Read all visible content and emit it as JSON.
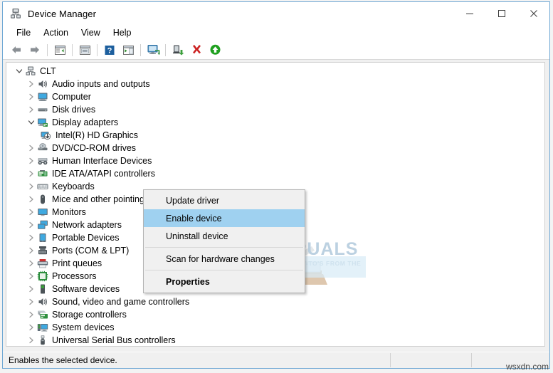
{
  "window": {
    "title": "Device Manager",
    "title_icon": "device-manager-icon",
    "controls": {
      "minimize": "minimize-icon",
      "maximize": "maximize-icon",
      "close": "close-icon"
    }
  },
  "menubar": {
    "items": [
      {
        "label": "File"
      },
      {
        "label": "Action"
      },
      {
        "label": "View"
      },
      {
        "label": "Help"
      }
    ]
  },
  "toolbar": {
    "buttons": [
      {
        "name": "back-icon",
        "title": "Back"
      },
      {
        "name": "forward-icon",
        "title": "Forward"
      },
      {
        "name": "separator-1",
        "title": ""
      },
      {
        "name": "show-hide-console-tree-icon",
        "title": "Show/Hide Console Tree"
      },
      {
        "name": "separator-2",
        "title": ""
      },
      {
        "name": "properties-icon",
        "title": "Properties"
      },
      {
        "name": "separator-3",
        "title": ""
      },
      {
        "name": "help-icon",
        "title": "Help"
      },
      {
        "name": "show-hide-action-pane-icon",
        "title": "Show/Hide Action Pane"
      },
      {
        "name": "separator-4",
        "title": ""
      },
      {
        "name": "scan-for-hardware-changes-icon",
        "title": "Scan for hardware changes"
      },
      {
        "name": "separator-5",
        "title": ""
      },
      {
        "name": "update-driver-icon",
        "title": "Update Driver Software"
      },
      {
        "name": "uninstall-device-icon",
        "title": "Uninstall device"
      },
      {
        "name": "enable-device-icon",
        "title": "Enable device"
      }
    ]
  },
  "tree": {
    "nodes": [
      {
        "label": "CLT",
        "depth": 0,
        "expander": "expanded",
        "icon": "computer-root-icon",
        "selected": false
      },
      {
        "label": "Audio inputs and outputs",
        "depth": 1,
        "expander": "collapsed",
        "icon": "audio-icon",
        "selected": false
      },
      {
        "label": "Computer",
        "depth": 1,
        "expander": "collapsed",
        "icon": "computer-icon",
        "selected": false
      },
      {
        "label": "Disk drives",
        "depth": 1,
        "expander": "collapsed",
        "icon": "disk-drive-icon",
        "selected": false
      },
      {
        "label": "Display adapters",
        "depth": 1,
        "expander": "expanded",
        "icon": "display-adapter-icon",
        "selected": false
      },
      {
        "label": "Intel(R) HD Graphics",
        "depth": 2,
        "expander": "none",
        "icon": "display-adapter-disabled-icon",
        "selected": true
      },
      {
        "label": "DVD/CD-ROM drives",
        "depth": 1,
        "expander": "collapsed",
        "icon": "dvd-drive-icon",
        "selected": false
      },
      {
        "label": "Human Interface Devices",
        "depth": 1,
        "expander": "collapsed",
        "icon": "hid-icon",
        "selected": false
      },
      {
        "label": "IDE ATA/ATAPI controllers",
        "depth": 1,
        "expander": "collapsed",
        "icon": "ide-controller-icon",
        "selected": false
      },
      {
        "label": "Keyboards",
        "depth": 1,
        "expander": "collapsed",
        "icon": "keyboard-icon",
        "selected": false
      },
      {
        "label": "Mice and other pointing devices",
        "depth": 1,
        "expander": "collapsed",
        "icon": "mouse-icon",
        "selected": false
      },
      {
        "label": "Monitors",
        "depth": 1,
        "expander": "collapsed",
        "icon": "monitor-icon",
        "selected": false
      },
      {
        "label": "Network adapters",
        "depth": 1,
        "expander": "collapsed",
        "icon": "network-adapter-icon",
        "selected": false
      },
      {
        "label": "Portable Devices",
        "depth": 1,
        "expander": "collapsed",
        "icon": "portable-device-icon",
        "selected": false
      },
      {
        "label": "Ports (COM & LPT)",
        "depth": 1,
        "expander": "collapsed",
        "icon": "port-icon",
        "selected": false
      },
      {
        "label": "Print queues",
        "depth": 1,
        "expander": "collapsed",
        "icon": "printer-icon",
        "selected": false
      },
      {
        "label": "Processors",
        "depth": 1,
        "expander": "collapsed",
        "icon": "processor-icon",
        "selected": false
      },
      {
        "label": "Software devices",
        "depth": 1,
        "expander": "collapsed",
        "icon": "software-device-icon",
        "selected": false
      },
      {
        "label": "Sound, video and game controllers",
        "depth": 1,
        "expander": "collapsed",
        "icon": "sound-controller-icon",
        "selected": false
      },
      {
        "label": "Storage controllers",
        "depth": 1,
        "expander": "collapsed",
        "icon": "storage-controller-icon",
        "selected": false
      },
      {
        "label": "System devices",
        "depth": 1,
        "expander": "collapsed",
        "icon": "system-device-icon",
        "selected": false
      },
      {
        "label": "Universal Serial Bus controllers",
        "depth": 1,
        "expander": "collapsed",
        "icon": "usb-controller-icon",
        "selected": false
      }
    ]
  },
  "context_menu": {
    "items": [
      {
        "label": "Update driver",
        "highlighted": false,
        "bold": false,
        "separator_after": false
      },
      {
        "label": "Enable device",
        "highlighted": true,
        "bold": false,
        "separator_after": false
      },
      {
        "label": "Uninstall device",
        "highlighted": false,
        "bold": false,
        "separator_after": true
      },
      {
        "label": "Scan for hardware changes",
        "highlighted": false,
        "bold": false,
        "separator_after": true
      },
      {
        "label": "Properties",
        "highlighted": false,
        "bold": true,
        "separator_after": false
      }
    ]
  },
  "watermark": {
    "brand": "APPUALS",
    "tagline": "TECH HOW-TO'S FROM THE EXPERTS!"
  },
  "statusbar": {
    "message": "Enables the selected device.",
    "pane2": "",
    "site": "wsxdn.com"
  },
  "colors": {
    "window_border": "#6fa8d4",
    "selection": "#cde8ff",
    "menu_highlight": "#9fd1f0",
    "chrome": "#f0f0f0",
    "accent_green": "#1fa01f",
    "accent_red": "#cc2222"
  }
}
